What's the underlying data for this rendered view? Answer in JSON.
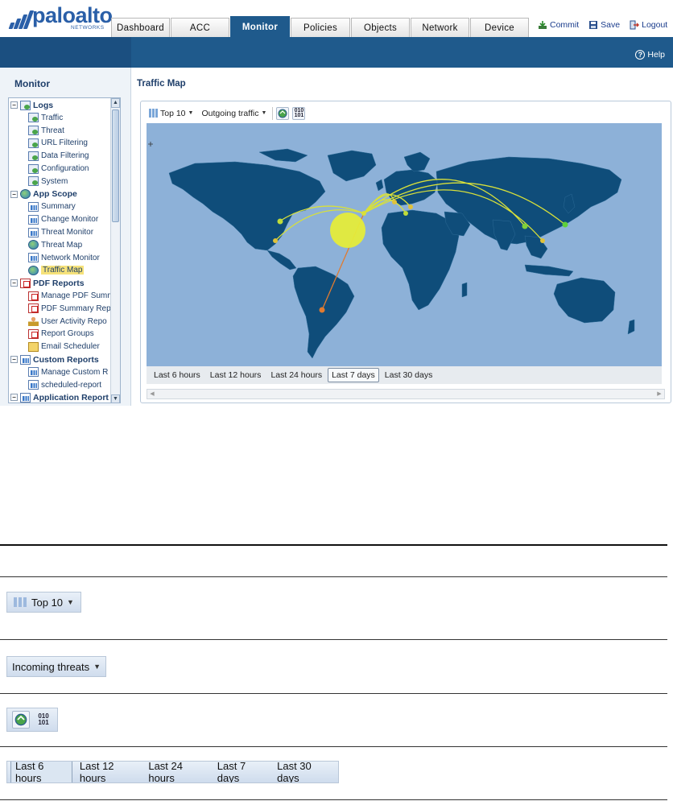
{
  "header": {
    "logo_text": "paloalto",
    "logo_sub": "NETWORKS",
    "tabs": [
      {
        "label": "Dashboard",
        "active": false
      },
      {
        "label": "ACC",
        "active": false
      },
      {
        "label": "Monitor",
        "active": true
      },
      {
        "label": "Policies",
        "active": false
      },
      {
        "label": "Objects",
        "active": false
      },
      {
        "label": "Network",
        "active": false
      },
      {
        "label": "Device",
        "active": false
      }
    ],
    "actions": {
      "commit": "Commit",
      "save": "Save",
      "logout": "Logout"
    },
    "help": "Help"
  },
  "sidebar": {
    "title": "Monitor",
    "tree": [
      {
        "label": "Logs",
        "group": true,
        "icon": "logs-icon"
      },
      {
        "label": "Traffic",
        "icon": "doc-icon"
      },
      {
        "label": "Threat",
        "icon": "doc-icon"
      },
      {
        "label": "URL Filtering",
        "icon": "doc-icon"
      },
      {
        "label": "Data Filtering",
        "icon": "doc-icon"
      },
      {
        "label": "Configuration",
        "icon": "doc-icon"
      },
      {
        "label": "System",
        "icon": "doc-icon"
      },
      {
        "label": "App Scope",
        "group": true,
        "icon": "globe-icon"
      },
      {
        "label": "Summary",
        "icon": "chart-icon"
      },
      {
        "label": "Change Monitor",
        "icon": "chart-icon"
      },
      {
        "label": "Threat Monitor",
        "icon": "chart-icon"
      },
      {
        "label": "Threat Map",
        "icon": "globe-icon"
      },
      {
        "label": "Network Monitor",
        "icon": "chart-icon"
      },
      {
        "label": "Traffic Map",
        "icon": "globe-icon",
        "selected": true
      },
      {
        "label": "PDF Reports",
        "group": true,
        "icon": "pdf-icon"
      },
      {
        "label": "Manage PDF Summ",
        "icon": "pdf-icon"
      },
      {
        "label": "PDF Summary Rep",
        "icon": "pdf-icon"
      },
      {
        "label": "User Activity Repo",
        "icon": "user-icon"
      },
      {
        "label": "Report Groups",
        "icon": "pdf-icon"
      },
      {
        "label": "Email Scheduler",
        "icon": "mail-icon"
      },
      {
        "label": "Custom Reports",
        "group": true,
        "icon": "chart-icon"
      },
      {
        "label": "Manage Custom R",
        "icon": "chart-icon"
      },
      {
        "label": "scheduled-report",
        "icon": "chart-icon"
      },
      {
        "label": "Application Report",
        "group": true,
        "icon": "chart-icon"
      }
    ]
  },
  "main": {
    "title": "Traffic Map",
    "toolbar": {
      "top": "Top 10",
      "direction": "Outgoing traffic",
      "binary_label": "010\n101"
    },
    "time_ranges": [
      {
        "label": "Last 6 hours",
        "active": false
      },
      {
        "label": "Last 12 hours",
        "active": false
      },
      {
        "label": "Last 24 hours",
        "active": false
      },
      {
        "label": "Last 7 days",
        "active": true
      },
      {
        "label": "Last 30 days",
        "active": false
      }
    ]
  },
  "legend": {
    "top_label": "Top 10",
    "direction_label": "Incoming threats",
    "binary_label": "010\n101",
    "time_ranges": [
      {
        "label": "Last 6 hours",
        "active": true
      },
      {
        "label": "Last 12 hours",
        "active": false
      },
      {
        "label": "Last 24 hours",
        "active": false
      },
      {
        "label": "Last 7 days",
        "active": false
      },
      {
        "label": "Last 30 days",
        "active": false
      }
    ]
  },
  "colors": {
    "brand": "#2a5fa8",
    "nav": "#1f5a8c",
    "map_ocean": "#8db1d8",
    "map_land": "#0f4d7a",
    "bubble": "#e5ec3a",
    "arc_orange": "#e07b30"
  }
}
